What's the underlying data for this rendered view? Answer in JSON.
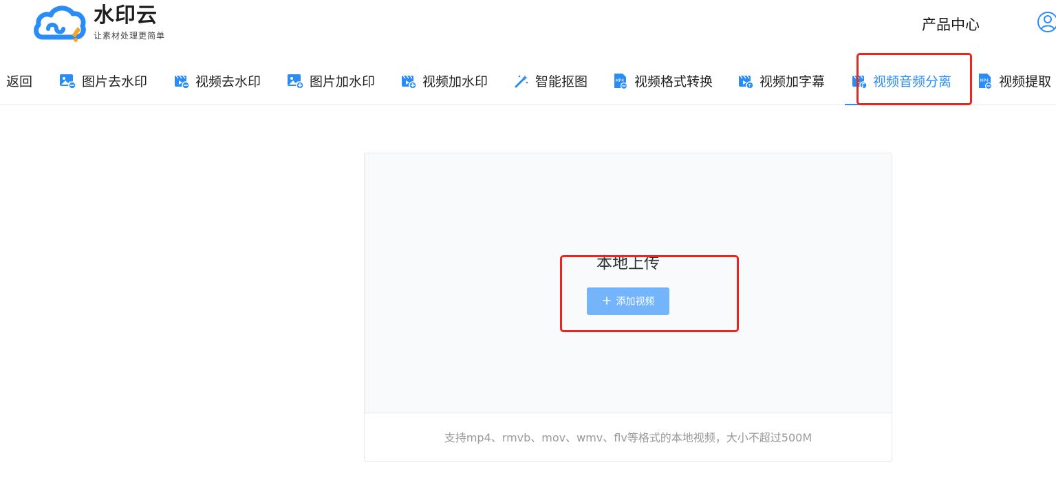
{
  "brand": {
    "name": "水印云",
    "slogan": "让素材处理更简单",
    "logo_icon": "cloud-logo-icon",
    "color": "#2a8cf7"
  },
  "header": {
    "product_center": "产品中心",
    "user_icon": "user-avatar-icon"
  },
  "toolbar": {
    "items": [
      {
        "label": "返回",
        "icon": ""
      },
      {
        "label": "图片去水印",
        "icon": "image-remove-icon"
      },
      {
        "label": "视频去水印",
        "icon": "video-remove-icon"
      },
      {
        "label": "图片加水印",
        "icon": "image-add-icon"
      },
      {
        "label": "视频加水印",
        "icon": "video-add-icon"
      },
      {
        "label": "智能抠图",
        "icon": "magic-wand-icon"
      },
      {
        "label": "视频格式转换",
        "icon": "mp4-convert-icon"
      },
      {
        "label": "视频加字幕",
        "icon": "video-subtitle-icon"
      },
      {
        "label": "视频音频分离",
        "icon": "video-audio-icon",
        "active": true
      },
      {
        "label": "视频提取",
        "icon": "mp4-extract-icon"
      }
    ]
  },
  "upload": {
    "title": "本地上传",
    "button_label": "添加视频",
    "note": "支持mp4、rmvb、mov、wmv、flv等格式的本地视频，大小不超过500M"
  },
  "colors": {
    "accent": "#2a8cf7",
    "button": "#74b4fb",
    "highlight": "#e8261e"
  }
}
